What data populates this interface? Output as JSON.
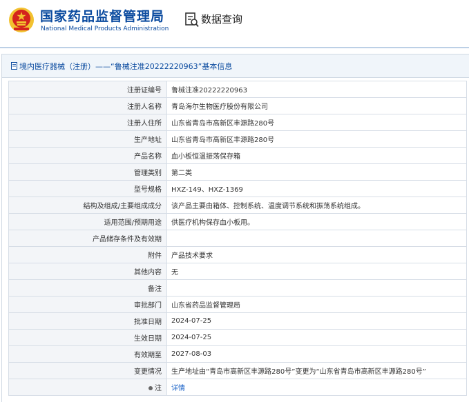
{
  "header": {
    "title_cn": "国家药品监督管理局",
    "title_en": "National Medical Products Administration",
    "query_label": "数据查询"
  },
  "panel": {
    "title": "境内医疗器械（注册）——“鲁械注准20222220963”基本信息"
  },
  "rows": [
    {
      "label": "注册证编号",
      "value": "鲁械注准20222220963"
    },
    {
      "label": "注册人名称",
      "value": "青岛海尔生物医疗股份有限公司"
    },
    {
      "label": "注册人住所",
      "value": "山东省青岛市高新区丰源路280号"
    },
    {
      "label": "生产地址",
      "value": "山东省青岛市高新区丰源路280号"
    },
    {
      "label": "产品名称",
      "value": "血小板恒温振荡保存箱"
    },
    {
      "label": "管理类别",
      "value": "第二类"
    },
    {
      "label": "型号规格",
      "value": "HXZ-149、HXZ-1369"
    },
    {
      "label": "结构及组成/主要组成成分",
      "value": "该产品主要由箱体、控制系统、温度调节系统和振荡系统组成。"
    },
    {
      "label": "适用范围/预期用途",
      "value": "供医疗机构保存血小板用。"
    },
    {
      "label": "产品储存条件及有效期",
      "value": ""
    },
    {
      "label": "附件",
      "value": "产品技术要求"
    },
    {
      "label": "其他内容",
      "value": "无"
    },
    {
      "label": "备注",
      "value": ""
    },
    {
      "label": "审批部门",
      "value": "山东省药品监督管理局"
    },
    {
      "label": "批准日期",
      "value": "2024-07-25"
    },
    {
      "label": "生效日期",
      "value": "2024-07-25"
    },
    {
      "label": "有效期至",
      "value": "2027-08-03"
    },
    {
      "label": "变更情况",
      "value": "生产地址由“青岛市高新区丰源路280号”变更为“山东省青岛市高新区丰源路280号”"
    },
    {
      "label": "注",
      "value": "详情"
    }
  ],
  "colors": {
    "brand": "#0a4a9f",
    "link": "#1d64c8",
    "emblem_red": "#d4231d",
    "emblem_gold": "#f2c230"
  },
  "icons": {
    "emblem": "national-emblem-icon",
    "query": "search-document-icon",
    "panel": "document-icon",
    "note": "info-dot-icon"
  }
}
